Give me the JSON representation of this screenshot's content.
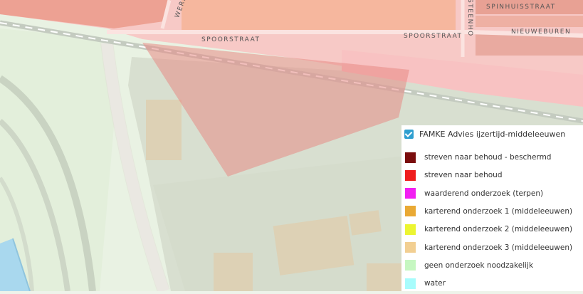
{
  "streets": {
    "werf_label": "WERF",
    "spinhuisstraat": "SPINHUISSTRAAT",
    "steenho": "STEENHO",
    "spoorstraat_west": "SPOORSTRAAT",
    "spoorstraat_east": "SPOORSTRAAT",
    "nieuweburen": "NIEUWEBUREN"
  },
  "legend": {
    "title": "FAMKE Advies ijzertijd-middeleeuwen",
    "checked": true,
    "items": [
      {
        "label": "streven naar behoud - beschermd",
        "color": "#7a0d0d"
      },
      {
        "label": "streven naar behoud",
        "color": "#ef1d1d"
      },
      {
        "label": "waarderend onderzoek (terpen)",
        "color": "#f21ff2"
      },
      {
        "label": "karterend onderzoek 1 (middeleeuwen)",
        "color": "#e9a934"
      },
      {
        "label": "karterend onderzoek 2 (middeleeuwen)",
        "color": "#ecf532"
      },
      {
        "label": "karterend onderzoek 3 (middeleeuwen)",
        "color": "#f2cf92"
      },
      {
        "label": "geen onderzoek noodzakelijk",
        "color": "#c6f7c1"
      },
      {
        "label": "water",
        "color": "#a8fcfc"
      }
    ]
  }
}
